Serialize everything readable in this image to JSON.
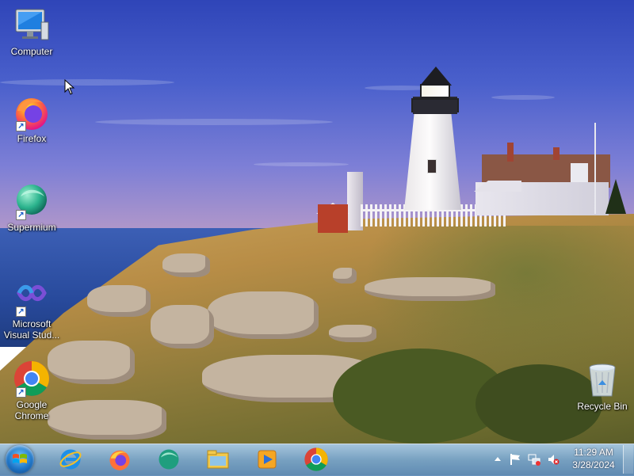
{
  "desktop": {
    "icons": [
      {
        "label": "Computer",
        "icon": "computer-icon"
      },
      {
        "label": "Firefox",
        "icon": "firefox-icon"
      },
      {
        "label": "Supermium",
        "icon": "supermium-icon"
      },
      {
        "label": "Microsoft Visual Stud...",
        "icon": "visual-studio-icon"
      },
      {
        "label": "Google Chrome",
        "icon": "chrome-icon"
      },
      {
        "label": "Recycle Bin",
        "icon": "recycle-bin-icon"
      }
    ]
  },
  "taskbar": {
    "start": {
      "icon": "windows-start-orb"
    },
    "pinned": [
      {
        "name": "Internet Explorer",
        "icon": "internet-explorer-icon"
      },
      {
        "name": "Firefox",
        "icon": "firefox-icon"
      },
      {
        "name": "Supermium",
        "icon": "supermium-icon"
      },
      {
        "name": "Windows Explorer",
        "icon": "folder-icon"
      },
      {
        "name": "Windows Media Player",
        "icon": "media-player-icon"
      },
      {
        "name": "Google Chrome",
        "icon": "chrome-icon"
      }
    ],
    "tray": {
      "icons": [
        "show-hidden-icons-arrow",
        "action-center-flag-icon",
        "network-icon",
        "volume-muted-icon"
      ],
      "time": "11:29 AM",
      "date": "3/28/2024"
    }
  },
  "colors": {
    "taskbar": "#7fa6cc",
    "chrome_red": "#db4437",
    "chrome_green": "#0f9d58",
    "chrome_yellow": "#f4b400",
    "chrome_blue": "#4285f4",
    "firefox_orange": "#ff7139"
  }
}
